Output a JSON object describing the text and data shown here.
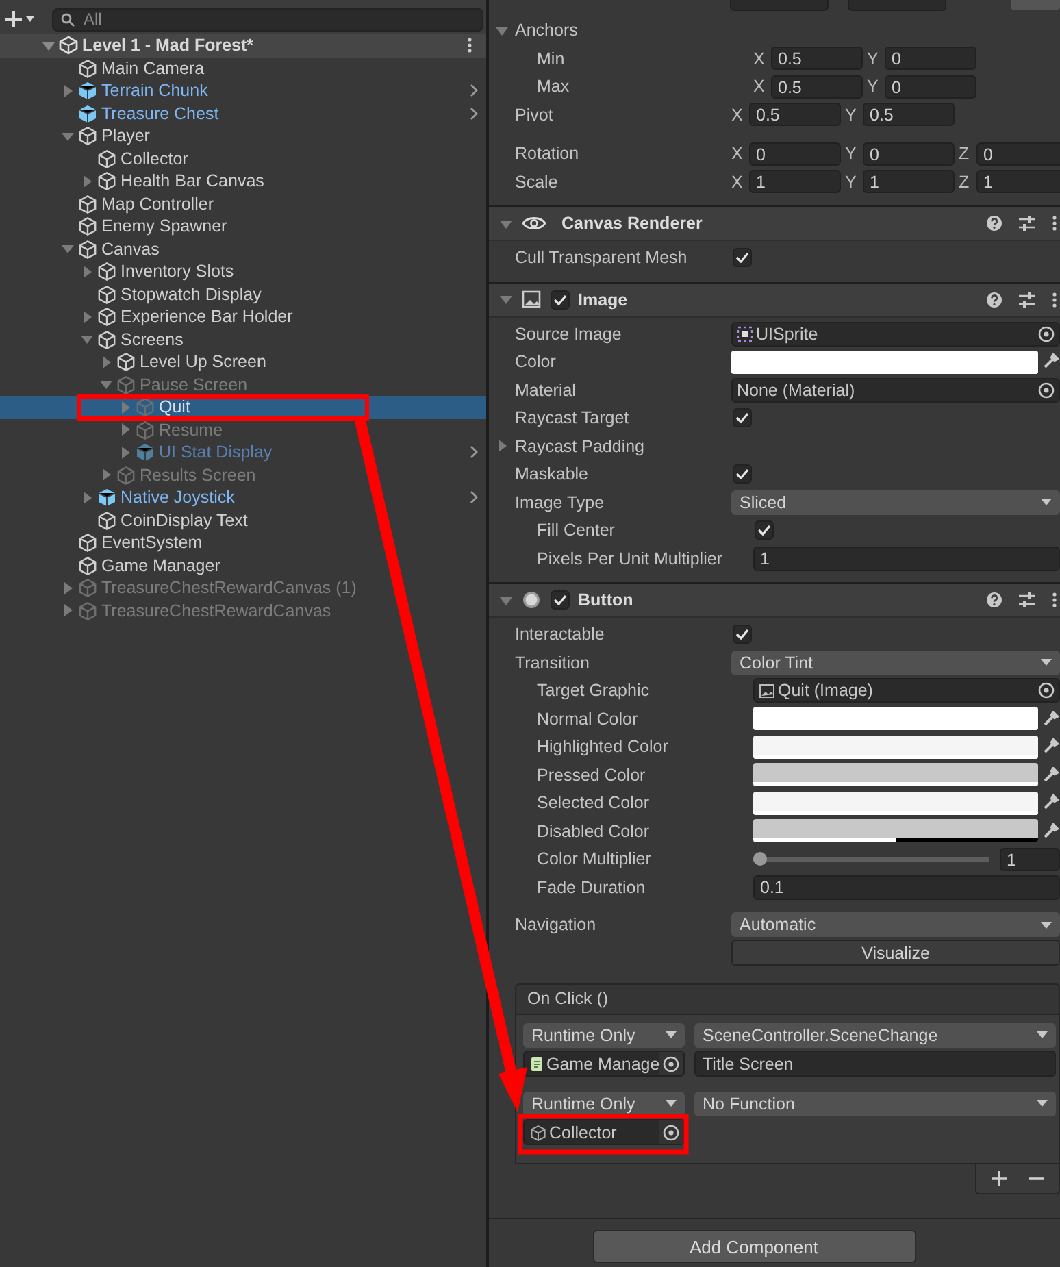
{
  "hierarchy": {
    "search": {
      "placeholder": "All"
    },
    "scene": {
      "name": "Level 1 - Mad Forest*",
      "expanded": true
    },
    "items": [
      {
        "name": "Main Camera",
        "prefab": false,
        "active": true,
        "selected": false
      },
      {
        "name": "Terrain Chunk",
        "expanded": false,
        "prefab": true,
        "active": true,
        "selected": false
      },
      {
        "name": "Treasure Chest",
        "prefab": true,
        "active": true,
        "selected": false
      },
      {
        "name": "Player",
        "expanded": true,
        "prefab": false,
        "active": true,
        "selected": false,
        "children": [
          {
            "name": "Collector",
            "prefab": false,
            "active": true,
            "selected": false
          },
          {
            "name": "Health Bar Canvas",
            "expanded": false,
            "prefab": false,
            "active": true,
            "selected": false
          }
        ]
      },
      {
        "name": "Map Controller",
        "prefab": false,
        "active": true,
        "selected": false
      },
      {
        "name": "Enemy Spawner",
        "prefab": false,
        "active": true,
        "selected": false
      },
      {
        "name": "Canvas",
        "expanded": true,
        "prefab": false,
        "active": true,
        "selected": false,
        "children": [
          {
            "name": "Inventory Slots",
            "expanded": false,
            "prefab": false,
            "active": true,
            "selected": false
          },
          {
            "name": "Stopwatch Display",
            "prefab": false,
            "active": true,
            "selected": false
          },
          {
            "name": "Experience Bar Holder",
            "expanded": false,
            "prefab": false,
            "active": true,
            "selected": false
          },
          {
            "name": "Screens",
            "expanded": true,
            "prefab": false,
            "active": true,
            "selected": false,
            "children": [
              {
                "name": "Level Up Screen",
                "expanded": false,
                "prefab": false,
                "active": true,
                "selected": false
              },
              {
                "name": "Pause Screen",
                "expanded": true,
                "prefab": false,
                "active": false,
                "selected": false,
                "children": [
                  {
                    "name": "Quit",
                    "expanded": false,
                    "prefab": false,
                    "active": false,
                    "selected": true
                  },
                  {
                    "name": "Resume",
                    "expanded": false,
                    "prefab": false,
                    "active": false,
                    "selected": false
                  },
                  {
                    "name": "UI Stat Display",
                    "expanded": false,
                    "prefab": true,
                    "active": false,
                    "selected": false
                  }
                ]
              },
              {
                "name": "Results Screen",
                "expanded": false,
                "prefab": false,
                "active": false,
                "selected": false
              }
            ]
          },
          {
            "name": "Native Joystick",
            "expanded": false,
            "prefab": true,
            "active": true,
            "selected": false
          },
          {
            "name": "CoinDisplay Text",
            "prefab": false,
            "active": true,
            "selected": false
          }
        ]
      },
      {
        "name": "EventSystem",
        "prefab": false,
        "active": true,
        "selected": false
      },
      {
        "name": "Game Manager",
        "prefab": false,
        "active": true,
        "selected": false
      },
      {
        "name": "TreasureChestRewardCanvas (1)",
        "expanded": false,
        "prefab": false,
        "active": false,
        "selected": false
      },
      {
        "name": "TreasureChestRewardCanvas",
        "expanded": false,
        "prefab": false,
        "active": false,
        "selected": false
      }
    ]
  },
  "inspector": {
    "components": [
      {
        "rows": [
          {
            "kind": "foldout",
            "label": "Anchors",
            "expanded": true,
            "children": [
              {
                "kind": "vector",
                "label": "Min",
                "fields": [
                  {
                    "axis": "X",
                    "value": "0.5"
                  },
                  {
                    "axis": "Y",
                    "value": "0"
                  }
                ]
              },
              {
                "kind": "vector",
                "label": "Max",
                "fields": [
                  {
                    "axis": "X",
                    "value": "0.5"
                  },
                  {
                    "axis": "Y",
                    "value": "0"
                  }
                ]
              }
            ]
          },
          {
            "kind": "vector",
            "label": "Pivot",
            "fields": [
              {
                "axis": "X",
                "value": "0.5"
              },
              {
                "axis": "Y",
                "value": "0.5"
              }
            ]
          },
          {
            "kind": "vector",
            "label": "Rotation",
            "fields": [
              {
                "axis": "X",
                "value": "0"
              },
              {
                "axis": "Y",
                "value": "0"
              },
              {
                "axis": "Z",
                "value": "0"
              }
            ]
          },
          {
            "kind": "vector",
            "label": "Scale",
            "fields": [
              {
                "axis": "X",
                "value": "1"
              },
              {
                "axis": "Y",
                "value": "1"
              },
              {
                "axis": "Z",
                "value": "1"
              }
            ]
          }
        ]
      },
      {
        "title": "Canvas Renderer",
        "expanded": true,
        "rows": [
          {
            "kind": "checkbox",
            "label": "Cull Transparent Mesh",
            "checked": true
          }
        ]
      },
      {
        "title": "Image",
        "enabled": true,
        "expanded": true,
        "rows": [
          {
            "kind": "object",
            "label": "Source Image",
            "value": "UISprite"
          },
          {
            "kind": "color",
            "label": "Color",
            "color": "#ffffff",
            "level": 1
          },
          {
            "kind": "object",
            "label": "Material",
            "value": "None (Material)"
          },
          {
            "kind": "checkbox",
            "label": "Raycast Target",
            "checked": true
          },
          {
            "kind": "foldout",
            "label": "Raycast Padding",
            "expanded": false
          },
          {
            "kind": "checkbox",
            "label": "Maskable",
            "checked": true
          },
          {
            "kind": "dropdown",
            "label": "Image Type",
            "value": "Sliced",
            "children": [
              {
                "kind": "checkbox",
                "label": "Fill Center",
                "checked": true
              },
              {
                "kind": "number",
                "label": "Pixels Per Unit Multiplier",
                "value": "1"
              }
            ]
          }
        ]
      },
      {
        "title": "Button",
        "enabled": true,
        "expanded": true,
        "rows": [
          {
            "kind": "checkbox",
            "label": "Interactable",
            "checked": true
          },
          {
            "kind": "dropdown",
            "label": "Transition",
            "value": "Color Tint",
            "children": [
              {
                "kind": "object",
                "label": "Target Graphic",
                "value": "Quit (Image)"
              },
              {
                "kind": "color",
                "label": "Normal Color",
                "color": "#ffffff",
                "level": 1
              },
              {
                "kind": "color",
                "label": "Highlighted Color",
                "color": "#f5f5f5",
                "level": 1
              },
              {
                "kind": "color",
                "label": "Pressed Color",
                "color": "#c8c8c8",
                "level": 1
              },
              {
                "kind": "color",
                "label": "Selected Color",
                "color": "#f5f5f5",
                "level": 1
              },
              {
                "kind": "color",
                "label": "Disabled Color",
                "color": "#c8c8c8",
                "level": 0.5
              },
              {
                "kind": "slider",
                "label": "Color Multiplier",
                "level": 0,
                "value": "1"
              },
              {
                "kind": "number",
                "label": "Fade Duration",
                "value": "0.1"
              }
            ]
          },
          {
            "kind": "dropdown",
            "label": "Navigation",
            "value": "Automatic"
          },
          {
            "kind": "button",
            "label": "Visualize"
          }
        ],
        "event": {
          "title": "On Click ()",
          "entries": [
            {
              "mode": "Runtime Only",
              "function": "SceneController.SceneChange",
              "target": "Game Manage",
              "argument": "Title Screen"
            },
            {
              "mode": "Runtime Only",
              "function": "No Function",
              "target": "Collector"
            }
          ]
        }
      }
    ],
    "add_component": "Add Component"
  }
}
